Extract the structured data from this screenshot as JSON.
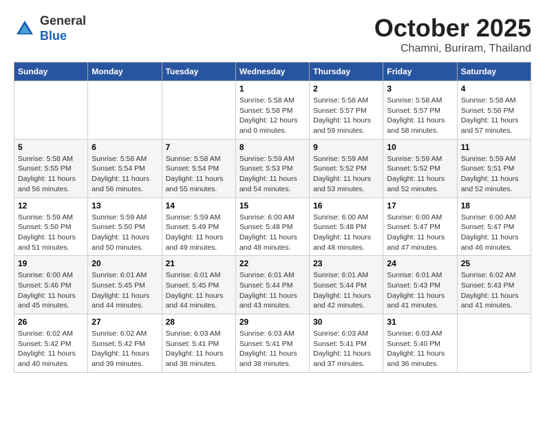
{
  "header": {
    "logo_general": "General",
    "logo_blue": "Blue",
    "month_title": "October 2025",
    "subtitle": "Chamni, Buriram, Thailand"
  },
  "weekdays": [
    "Sunday",
    "Monday",
    "Tuesday",
    "Wednesday",
    "Thursday",
    "Friday",
    "Saturday"
  ],
  "weeks": [
    [
      {
        "day": "",
        "info": ""
      },
      {
        "day": "",
        "info": ""
      },
      {
        "day": "",
        "info": ""
      },
      {
        "day": "1",
        "info": "Sunrise: 5:58 AM\nSunset: 5:58 PM\nDaylight: 12 hours\nand 0 minutes."
      },
      {
        "day": "2",
        "info": "Sunrise: 5:58 AM\nSunset: 5:57 PM\nDaylight: 11 hours\nand 59 minutes."
      },
      {
        "day": "3",
        "info": "Sunrise: 5:58 AM\nSunset: 5:57 PM\nDaylight: 11 hours\nand 58 minutes."
      },
      {
        "day": "4",
        "info": "Sunrise: 5:58 AM\nSunset: 5:56 PM\nDaylight: 11 hours\nand 57 minutes."
      }
    ],
    [
      {
        "day": "5",
        "info": "Sunrise: 5:58 AM\nSunset: 5:55 PM\nDaylight: 11 hours\nand 56 minutes."
      },
      {
        "day": "6",
        "info": "Sunrise: 5:58 AM\nSunset: 5:54 PM\nDaylight: 11 hours\nand 56 minutes."
      },
      {
        "day": "7",
        "info": "Sunrise: 5:58 AM\nSunset: 5:54 PM\nDaylight: 11 hours\nand 55 minutes."
      },
      {
        "day": "8",
        "info": "Sunrise: 5:59 AM\nSunset: 5:53 PM\nDaylight: 11 hours\nand 54 minutes."
      },
      {
        "day": "9",
        "info": "Sunrise: 5:59 AM\nSunset: 5:52 PM\nDaylight: 11 hours\nand 53 minutes."
      },
      {
        "day": "10",
        "info": "Sunrise: 5:59 AM\nSunset: 5:52 PM\nDaylight: 11 hours\nand 52 minutes."
      },
      {
        "day": "11",
        "info": "Sunrise: 5:59 AM\nSunset: 5:51 PM\nDaylight: 11 hours\nand 52 minutes."
      }
    ],
    [
      {
        "day": "12",
        "info": "Sunrise: 5:59 AM\nSunset: 5:50 PM\nDaylight: 11 hours\nand 51 minutes."
      },
      {
        "day": "13",
        "info": "Sunrise: 5:59 AM\nSunset: 5:50 PM\nDaylight: 11 hours\nand 50 minutes."
      },
      {
        "day": "14",
        "info": "Sunrise: 5:59 AM\nSunset: 5:49 PM\nDaylight: 11 hours\nand 49 minutes."
      },
      {
        "day": "15",
        "info": "Sunrise: 6:00 AM\nSunset: 5:48 PM\nDaylight: 11 hours\nand 48 minutes."
      },
      {
        "day": "16",
        "info": "Sunrise: 6:00 AM\nSunset: 5:48 PM\nDaylight: 11 hours\nand 48 minutes."
      },
      {
        "day": "17",
        "info": "Sunrise: 6:00 AM\nSunset: 5:47 PM\nDaylight: 11 hours\nand 47 minutes."
      },
      {
        "day": "18",
        "info": "Sunrise: 6:00 AM\nSunset: 5:47 PM\nDaylight: 11 hours\nand 46 minutes."
      }
    ],
    [
      {
        "day": "19",
        "info": "Sunrise: 6:00 AM\nSunset: 5:46 PM\nDaylight: 11 hours\nand 45 minutes."
      },
      {
        "day": "20",
        "info": "Sunrise: 6:01 AM\nSunset: 5:45 PM\nDaylight: 11 hours\nand 44 minutes."
      },
      {
        "day": "21",
        "info": "Sunrise: 6:01 AM\nSunset: 5:45 PM\nDaylight: 11 hours\nand 44 minutes."
      },
      {
        "day": "22",
        "info": "Sunrise: 6:01 AM\nSunset: 5:44 PM\nDaylight: 11 hours\nand 43 minutes."
      },
      {
        "day": "23",
        "info": "Sunrise: 6:01 AM\nSunset: 5:44 PM\nDaylight: 11 hours\nand 42 minutes."
      },
      {
        "day": "24",
        "info": "Sunrise: 6:01 AM\nSunset: 5:43 PM\nDaylight: 11 hours\nand 41 minutes."
      },
      {
        "day": "25",
        "info": "Sunrise: 6:02 AM\nSunset: 5:43 PM\nDaylight: 11 hours\nand 41 minutes."
      }
    ],
    [
      {
        "day": "26",
        "info": "Sunrise: 6:02 AM\nSunset: 5:42 PM\nDaylight: 11 hours\nand 40 minutes."
      },
      {
        "day": "27",
        "info": "Sunrise: 6:02 AM\nSunset: 5:42 PM\nDaylight: 11 hours\nand 39 minutes."
      },
      {
        "day": "28",
        "info": "Sunrise: 6:03 AM\nSunset: 5:41 PM\nDaylight: 11 hours\nand 38 minutes."
      },
      {
        "day": "29",
        "info": "Sunrise: 6:03 AM\nSunset: 5:41 PM\nDaylight: 11 hours\nand 38 minutes."
      },
      {
        "day": "30",
        "info": "Sunrise: 6:03 AM\nSunset: 5:41 PM\nDaylight: 11 hours\nand 37 minutes."
      },
      {
        "day": "31",
        "info": "Sunrise: 6:03 AM\nSunset: 5:40 PM\nDaylight: 11 hours\nand 36 minutes."
      },
      {
        "day": "",
        "info": ""
      }
    ]
  ]
}
